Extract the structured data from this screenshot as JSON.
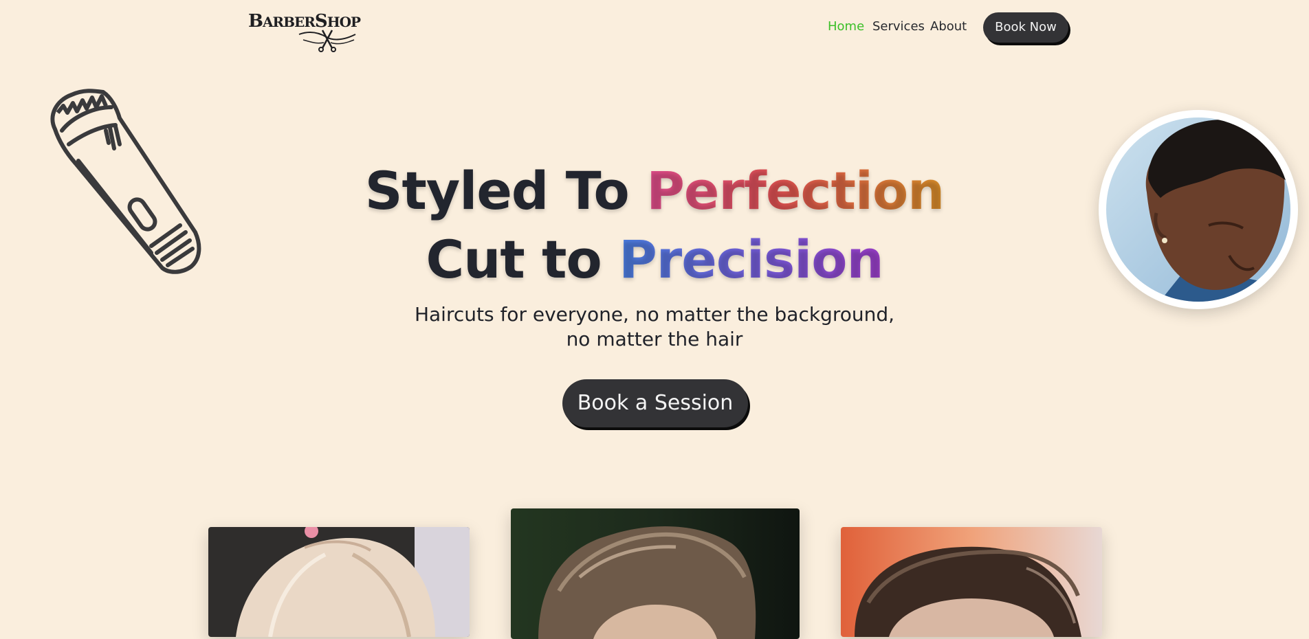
{
  "brand": {
    "logo_text": "BarberShop",
    "logo_icon": "scissors-icon"
  },
  "nav": {
    "links": [
      {
        "label": "Home",
        "active": true
      },
      {
        "label": "Services",
        "active": false
      },
      {
        "label": "About",
        "active": false
      }
    ],
    "cta_label": "Book Now"
  },
  "hero": {
    "line1_plain": "Styled To ",
    "line1_highlight": "Perfection",
    "line2_plain": "Cut to ",
    "line2_highlight": "Precision",
    "subtitle": "Haircuts for everyone, no matter the background, no matter the hair",
    "cta_label": "Book a Session"
  },
  "decor": {
    "left_icon": "hair-clipper-icon",
    "right_image": "man-fade-haircut-photo"
  },
  "gallery": [
    "blonde-hair-photo",
    "quiff-haircut-photo",
    "pompadour-haircut-photo"
  ],
  "colors": {
    "background": "#faeedd",
    "button": "#333336",
    "active_link": "#3bbf28",
    "perfection_gradient": [
      "#df4d8d",
      "#de5150",
      "#d88e2a"
    ],
    "precision_gradient": [
      "#4a7ee0",
      "#7a58d6",
      "#9c3ec9"
    ]
  }
}
